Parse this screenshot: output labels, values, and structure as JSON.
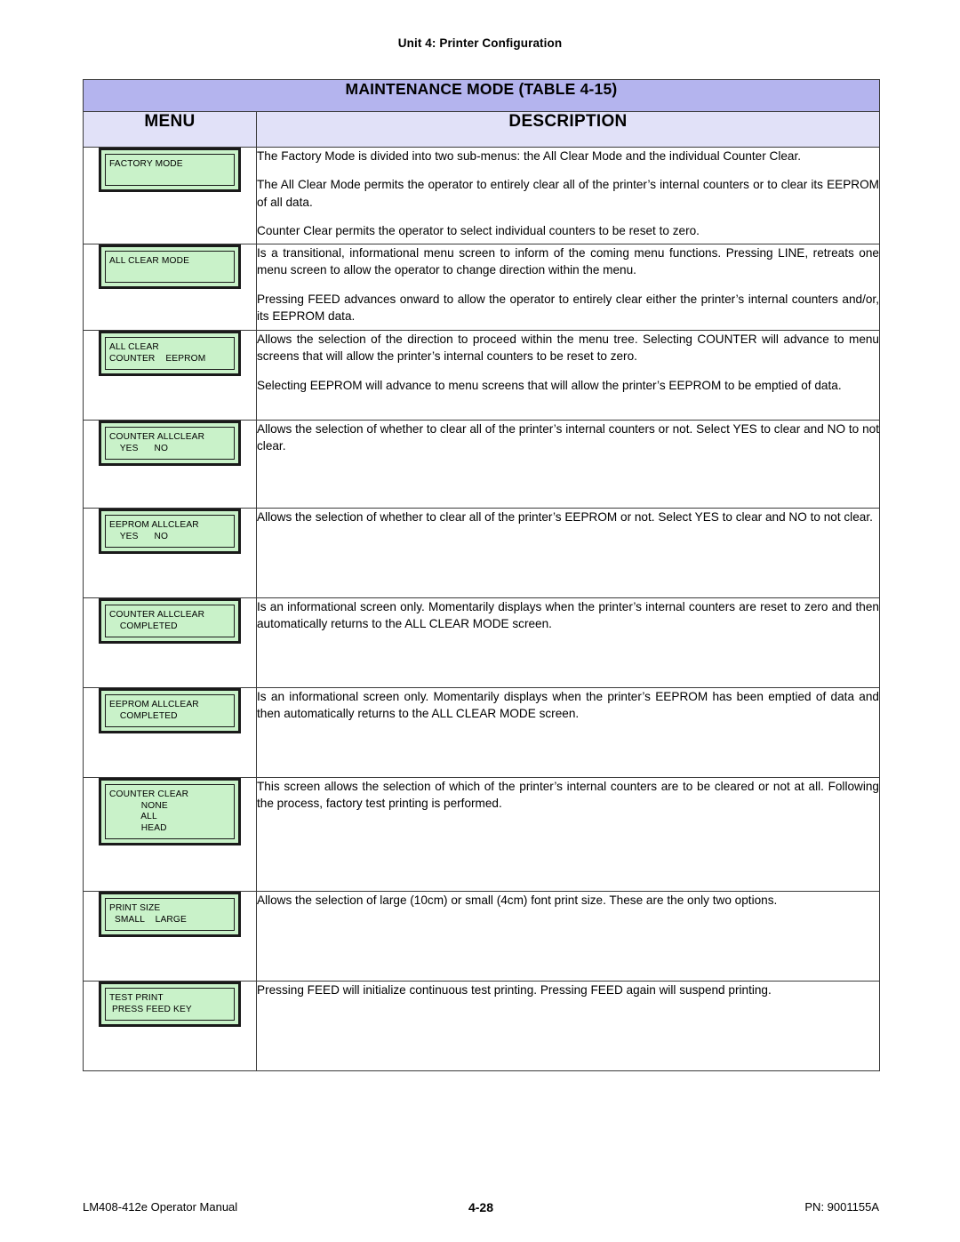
{
  "running_head": "Unit 4:  Printer Configuration",
  "table": {
    "title": "MAINTENANCE MODE (TABLE 4-15)",
    "columns": {
      "menu": "MENU",
      "description": "DESCRIPTION"
    },
    "rows": [
      {
        "lcd": [
          "FACTORY MODE"
        ],
        "paragraphs": [
          "The Factory Mode is divided into two sub-menus: the All Clear Mode and the individual Counter Clear.",
          "The All Clear Mode permits the operator to entirely clear all of the printer’s internal counters or to clear its EEPROM of all data.",
          "Counter Clear permits the operator to select individual counters to be reset to zero."
        ]
      },
      {
        "lcd": [
          "ALL CLEAR MODE"
        ],
        "paragraphs": [
          "Is a transitional, informational menu screen to inform of the coming menu functions. Pressing LINE, retreats one menu screen to allow the operator to change direction within the menu.",
          "Pressing FEED advances onward to allow the operator to entirely clear either the printer’s internal counters and/or, its EEPROM data."
        ]
      },
      {
        "lcd": [
          "ALL CLEAR",
          "COUNTER    EEPROM"
        ],
        "paragraphs": [
          "Allows the selection of the direction to proceed within the menu tree. Selecting COUNTER will advance to menu screens that will allow the printer’s internal counters to be reset to zero.",
          "Selecting EEPROM will advance to menu screens that will allow the printer’s EEPROM to be emptied of data."
        ]
      },
      {
        "lcd": [
          "COUNTER ALLCLEAR",
          "    YES      NO"
        ],
        "paragraphs": [
          "Allows the selection of whether to clear all of the printer’s internal counters or not. Select YES to clear and NO to not clear."
        ]
      },
      {
        "lcd": [
          "EEPROM ALLCLEAR",
          "    YES      NO"
        ],
        "paragraphs": [
          "Allows the selection of whether to clear all of the printer’s EEPROM or not. Select YES to clear and NO to not clear."
        ]
      },
      {
        "lcd": [
          "COUNTER ALLCLEAR",
          "    COMPLETED"
        ],
        "paragraphs": [
          "Is an informational screen only. Momentarily displays when the printer’s internal counters are reset to zero and then automatically returns to the ALL CLEAR MODE screen."
        ]
      },
      {
        "lcd": [
          "EEPROM ALLCLEAR",
          "    COMPLETED"
        ],
        "paragraphs": [
          "Is an informational screen only. Momentarily displays when the printer’s EEPROM has been emptied of data and then automatically returns to the ALL CLEAR MODE screen."
        ]
      },
      {
        "lcd": [
          "COUNTER CLEAR",
          "            NONE",
          "            ALL",
          "            HEAD"
        ],
        "paragraphs": [
          "This screen allows the selection of which of the printer’s internal counters are to be cleared or not at all. Following the process, factory test printing is performed."
        ]
      },
      {
        "lcd": [
          "PRINT SIZE",
          "  SMALL    LARGE"
        ],
        "paragraphs": [
          "Allows the selection of large (10cm) or small (4cm) font print size. These are the only two options."
        ]
      },
      {
        "lcd": [
          "TEST PRINT",
          " PRESS FEED KEY"
        ],
        "paragraphs": [
          "Pressing FEED will initialize continuous test printing. Pressing FEED again will suspend printing."
        ]
      }
    ]
  },
  "footer": {
    "left": "LM408-412e Operator Manual",
    "center": "4-28",
    "right": "PN: 9001155A"
  },
  "colors": {
    "title_bg": "#b4b4ee",
    "column_head_bg": "#e1e1f8",
    "lcd_bg": "#c9f2c9",
    "border": "#3a3a3a"
  }
}
